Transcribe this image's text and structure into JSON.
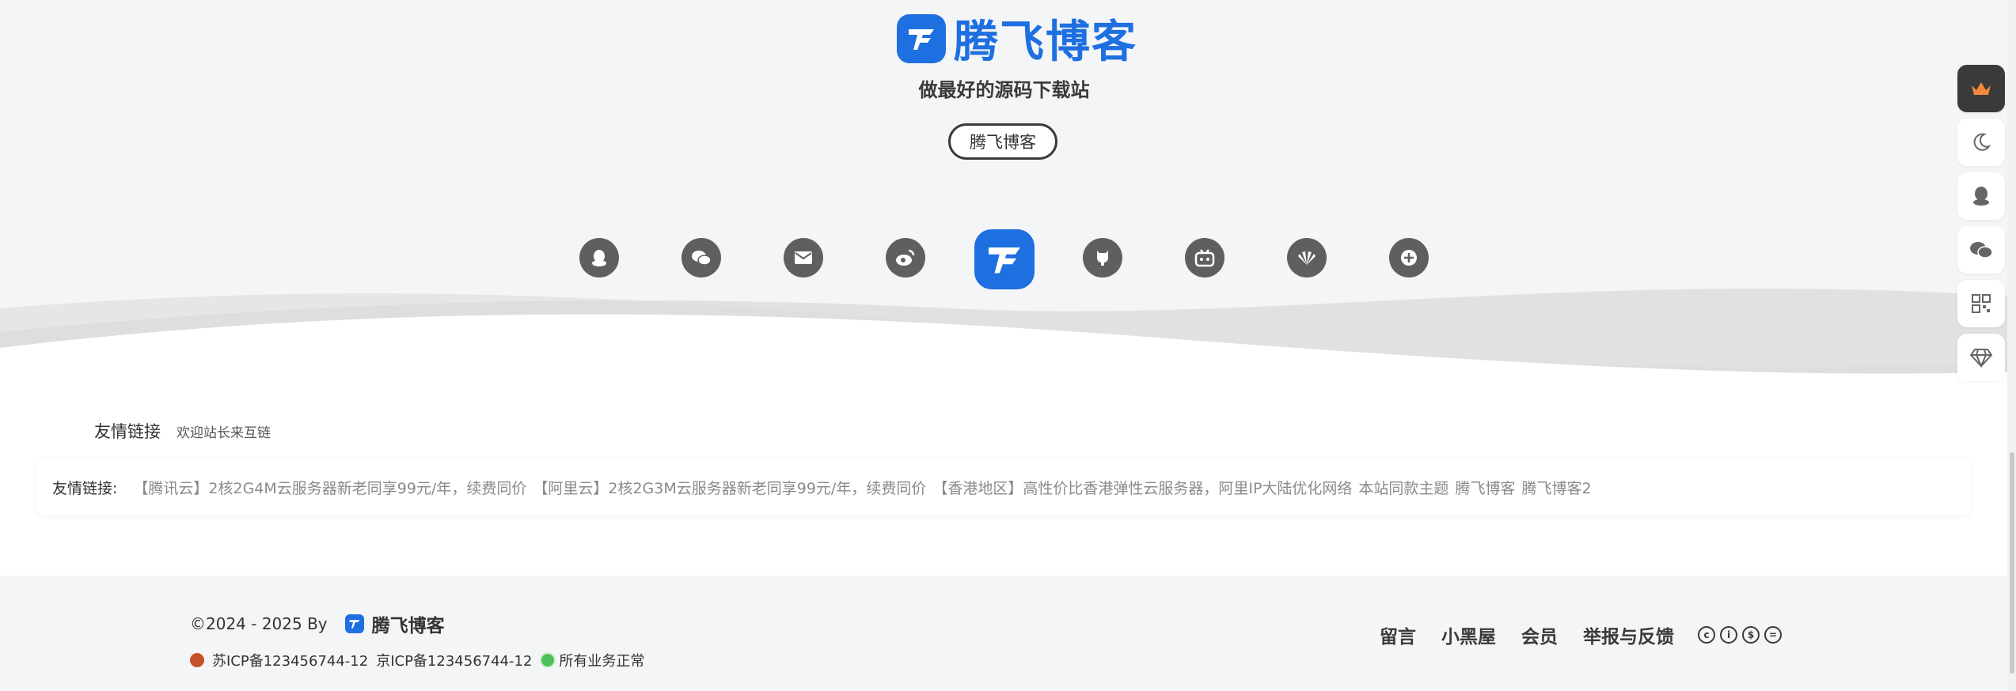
{
  "hero": {
    "logo_text": "腾飞博客",
    "tagline": "做最好的源码下载站",
    "button_label": "腾飞博客",
    "social_icons": [
      "qq-icon",
      "wechat-icon",
      "mail-icon",
      "weibo-icon",
      "site-logo-icon",
      "github-icon",
      "bilibili-icon",
      "huawei-icon",
      "plus-icon"
    ]
  },
  "float_bar": {
    "icons": [
      "crown-icon",
      "moon-icon",
      "qq-icon",
      "wechat-icon",
      "qrcode-icon",
      "diamond-icon"
    ]
  },
  "links": {
    "title": "友情链接",
    "subtitle": "欢迎站长来互链",
    "label": "友情链接:",
    "items": [
      "【腾讯云】2核2G4M云服务器新老同享99元/年，续费同价",
      "【阿里云】2核2G3M云服务器新老同享99元/年，续费同价",
      "【香港地区】高性价比香港弹性云服务器，阿里IP大陆优化网络",
      "本站同款主题",
      "腾飞博客",
      "腾飞博客2"
    ]
  },
  "footer": {
    "copyright": "©2024 - 2025 By",
    "brand": "腾飞博客",
    "icp1": "苏ICP备123456744-12",
    "icp2": "京ICP备123456744-12",
    "status": "所有业务正常",
    "nav": [
      "留言",
      "小黑屋",
      "会员",
      "举报与反馈"
    ],
    "cc_icons": [
      "cc-icon",
      "by-icon",
      "nc-icon",
      "nd-icon"
    ]
  },
  "colors": {
    "brand_blue": "#1e6fe0",
    "hero_bg": "#f4f5f7",
    "icon_gray": "#5f5f5f",
    "status_green": "#4cc05a"
  }
}
